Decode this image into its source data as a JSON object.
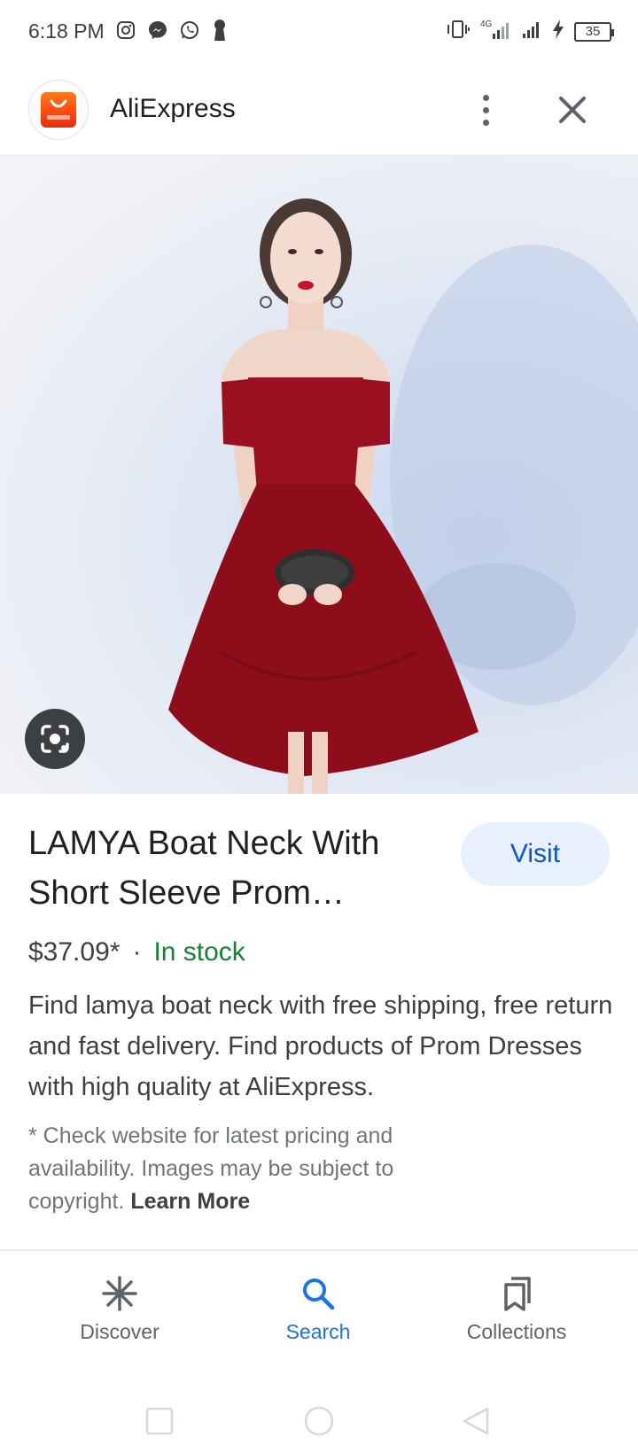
{
  "status_bar": {
    "time": "6:18 PM",
    "left_icons": [
      "instagram-icon",
      "messenger-icon",
      "whatsapp-icon",
      "keyhole-icon"
    ],
    "right_icons": [
      "vibrate-icon",
      "4g-signal-icon",
      "signal-icon",
      "charging-icon"
    ],
    "battery": "35"
  },
  "header": {
    "app_name": "AliExpress",
    "logo_text": "AliExpress"
  },
  "result": {
    "title": "LAMYA Boat Neck With Short Sleeve Prom…",
    "visit_label": "Visit",
    "price": "$37.09*",
    "separator": "·",
    "stock": "In stock",
    "description": "Find lamya boat neck with free shipping, free return and fast delivery. Find products of Prom Dresses with high quality at AliExpress.",
    "disclaimer": "* Check website for latest pricing and availability. Images may be subject to copyright.",
    "learn_more": "Learn More"
  },
  "bottom_nav": {
    "items": [
      {
        "label": "Discover",
        "icon": "asterisk-icon",
        "active": false
      },
      {
        "label": "Search",
        "icon": "search-icon",
        "active": true
      },
      {
        "label": "Collections",
        "icon": "collections-icon",
        "active": false
      }
    ]
  },
  "colors": {
    "accent": "#1a73e8",
    "visit_bg": "#e8f0fe",
    "stock_green": "#188038",
    "dress_red": "#9b1020",
    "aliexpress_orange": "#ff4b12"
  }
}
